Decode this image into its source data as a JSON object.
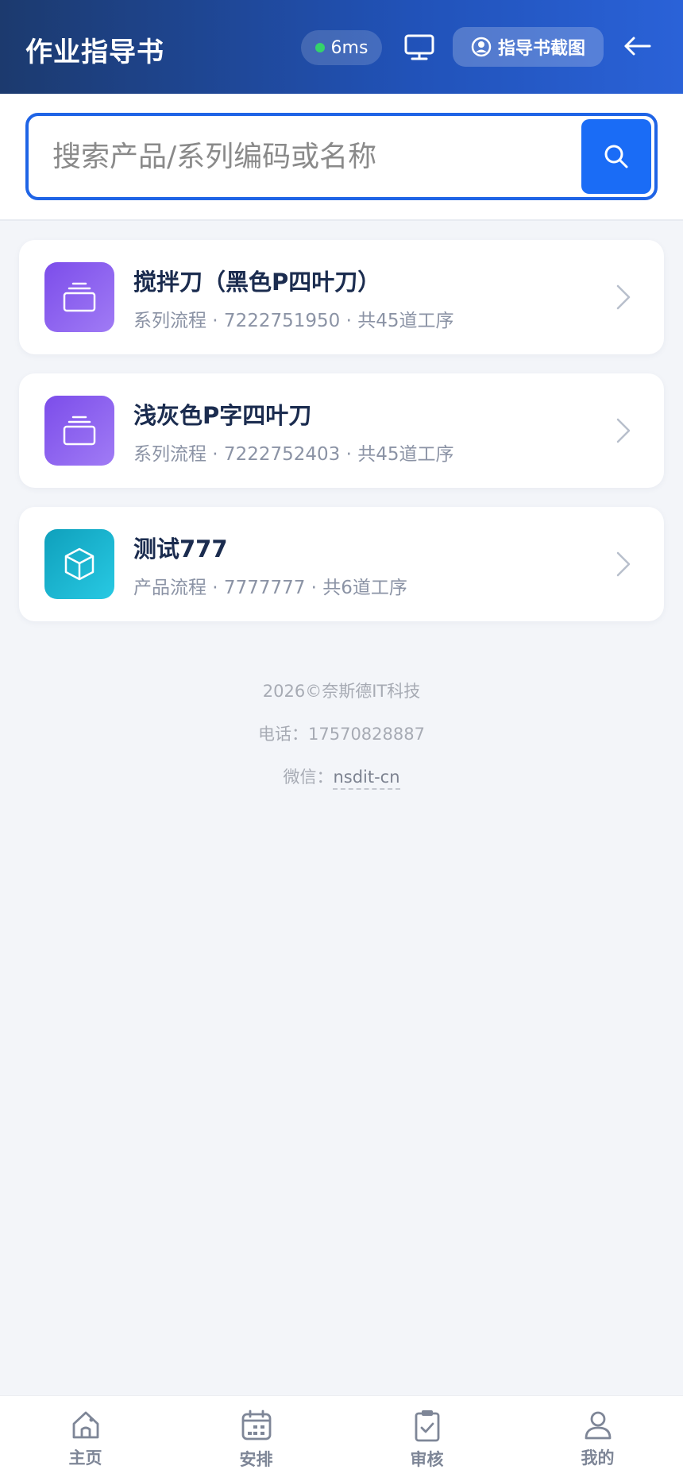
{
  "header": {
    "title": "作业指导书",
    "latency": "6ms",
    "screenshot_button": "指导书截图"
  },
  "search": {
    "placeholder": "搜索产品/系列编码或名称"
  },
  "items": [
    {
      "title": "搅拌刀（黑色P四叶刀）",
      "meta": "系列流程 · 7222751950 · 共45道工序",
      "icon": "layers-icon"
    },
    {
      "title": "浅灰色P字四叶刀",
      "meta": "系列流程 · 7222752403 · 共45道工序",
      "icon": "layers-icon"
    },
    {
      "title": "测试777",
      "meta": "产品流程 · 7777777 · 共6道工序",
      "icon": "cube-icon"
    }
  ],
  "footer": {
    "copyright": "2026©奈斯德IT科技",
    "phone": "电话：17570828887",
    "wechat_label": "微信：",
    "wechat_id": "nsdit-cn"
  },
  "nav": {
    "home": "主页",
    "schedule": "安排",
    "review": "审核",
    "mine": "我的"
  },
  "colors": {
    "accent": "#1a6cf6",
    "status_online": "#34d36b"
  }
}
